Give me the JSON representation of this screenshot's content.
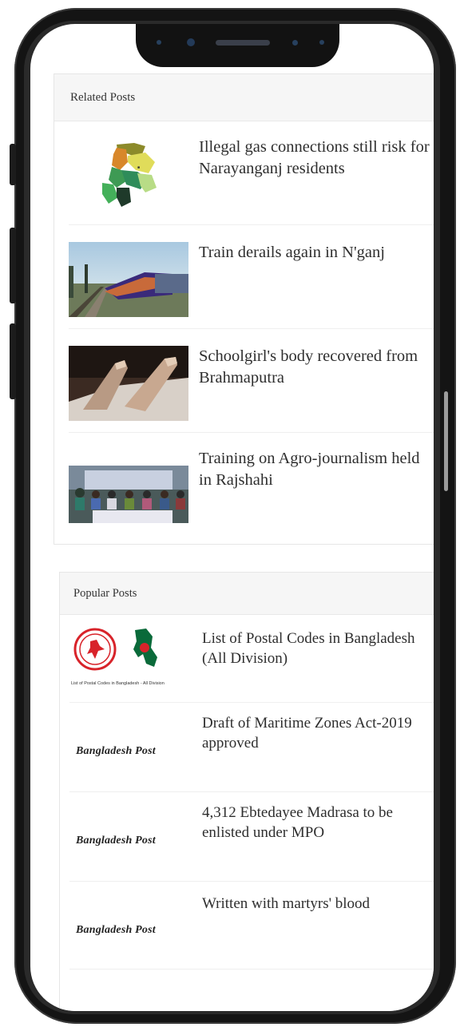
{
  "related": {
    "heading": "Related Posts",
    "posts": [
      {
        "title": "Illegal gas connections still risk for Narayanganj residents",
        "thumb": "map-thumbnail"
      },
      {
        "title": "Train derails again in N'ganj",
        "thumb": "train-photo-thumbnail"
      },
      {
        "title": "Schoolgirl's body recovered from Brahmaputra",
        "thumb": "feet-photo-thumbnail"
      },
      {
        "title": "Training on Agro-journalism held in Rajshahi",
        "thumb": "meeting-photo-thumbnail"
      }
    ]
  },
  "popular": {
    "heading": "Popular Posts",
    "posts": [
      {
        "title": "List of Postal Codes in Bangladesh (All Division)",
        "thumb_caption": "List of Postal Codes in Bangladesh - All Division"
      },
      {
        "title": "Draft of Maritime Zones Act-2019 approved",
        "brand": "Bangladesh Post"
      },
      {
        "title": "4,312 Ebtedayee Madrasa to be enlisted under MPO",
        "brand": "Bangladesh Post"
      },
      {
        "title": "Written with martyrs' blood",
        "brand": "Bangladesh Post"
      }
    ]
  },
  "colors": {
    "frame": "#141414",
    "widget_head_bg": "#f6f6f6",
    "text": "#2e2e2e",
    "postal_red": "#d8232a",
    "flag_green": "#0a6a3a"
  }
}
